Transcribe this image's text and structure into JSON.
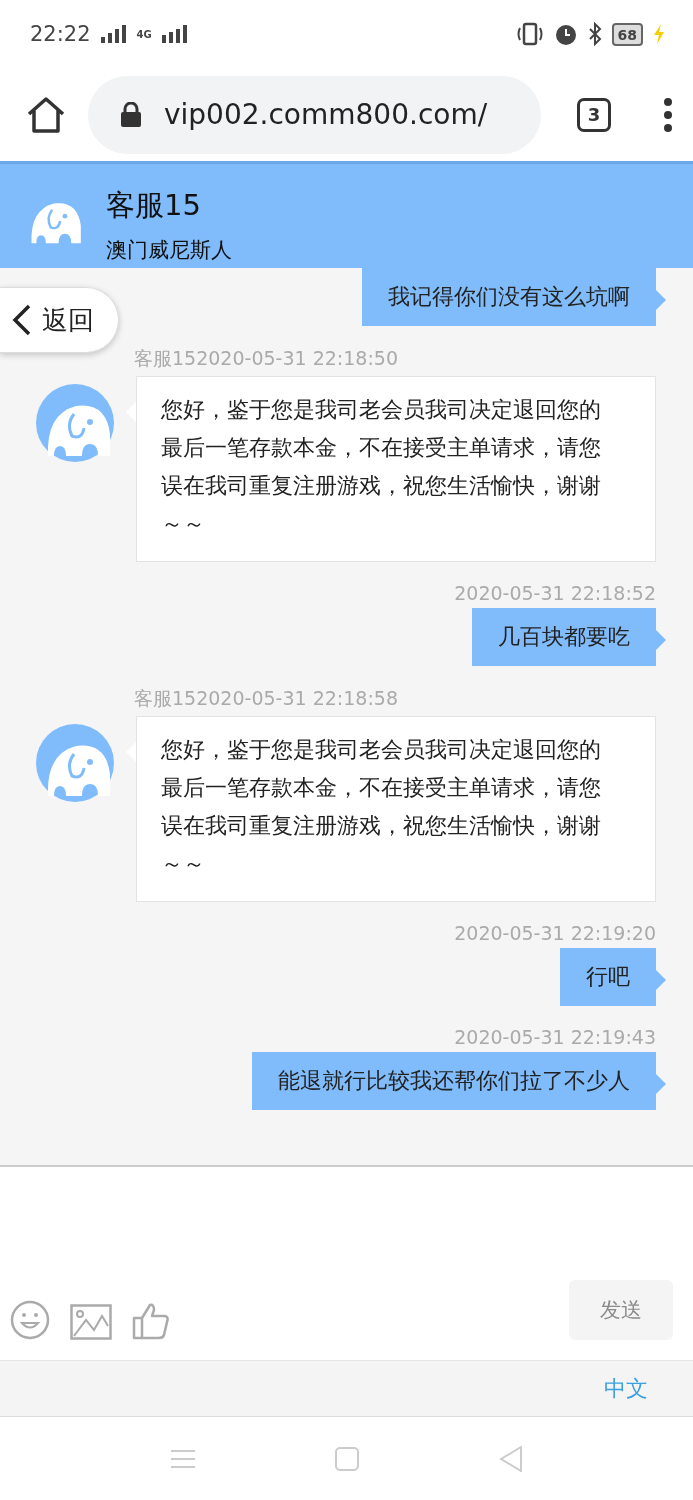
{
  "status_bar": {
    "time": "22:22",
    "network": "4G",
    "battery": "68",
    "charging": true
  },
  "browser": {
    "url": "vip002.comm800.com/",
    "tab_count": "3"
  },
  "chat_header": {
    "title": "客服15",
    "subtitle": "澳门威尼斯人"
  },
  "back_button": {
    "label": "返回"
  },
  "messages": [
    {
      "kind": "out",
      "text": "我记得你们没有这么坑啊"
    },
    {
      "kind": "in",
      "meta": "客服152020-05-31 22:18:50",
      "text": "您好，鉴于您是我司老会员我司决定退回您的最后一笔存款本金，不在接受主单请求，请您误在我司重复注册游戏，祝您生活愉快，谢谢～～"
    },
    {
      "kind": "out",
      "meta": "2020-05-31 22:18:52",
      "text": "几百块都要吃"
    },
    {
      "kind": "in",
      "meta": "客服152020-05-31 22:18:58",
      "text": "您好，鉴于您是我司老会员我司决定退回您的最后一笔存款本金，不在接受主单请求，请您误在我司重复注册游戏，祝您生活愉快，谢谢～～"
    },
    {
      "kind": "out",
      "meta": "2020-05-31 22:19:20",
      "text": "行吧"
    },
    {
      "kind": "out",
      "meta": "2020-05-31 22:19:43",
      "text": "能退就行比较我还帮你们拉了不少人"
    }
  ],
  "composer": {
    "send_label": "发送",
    "send_disabled": true
  },
  "language": {
    "label": "中文"
  }
}
